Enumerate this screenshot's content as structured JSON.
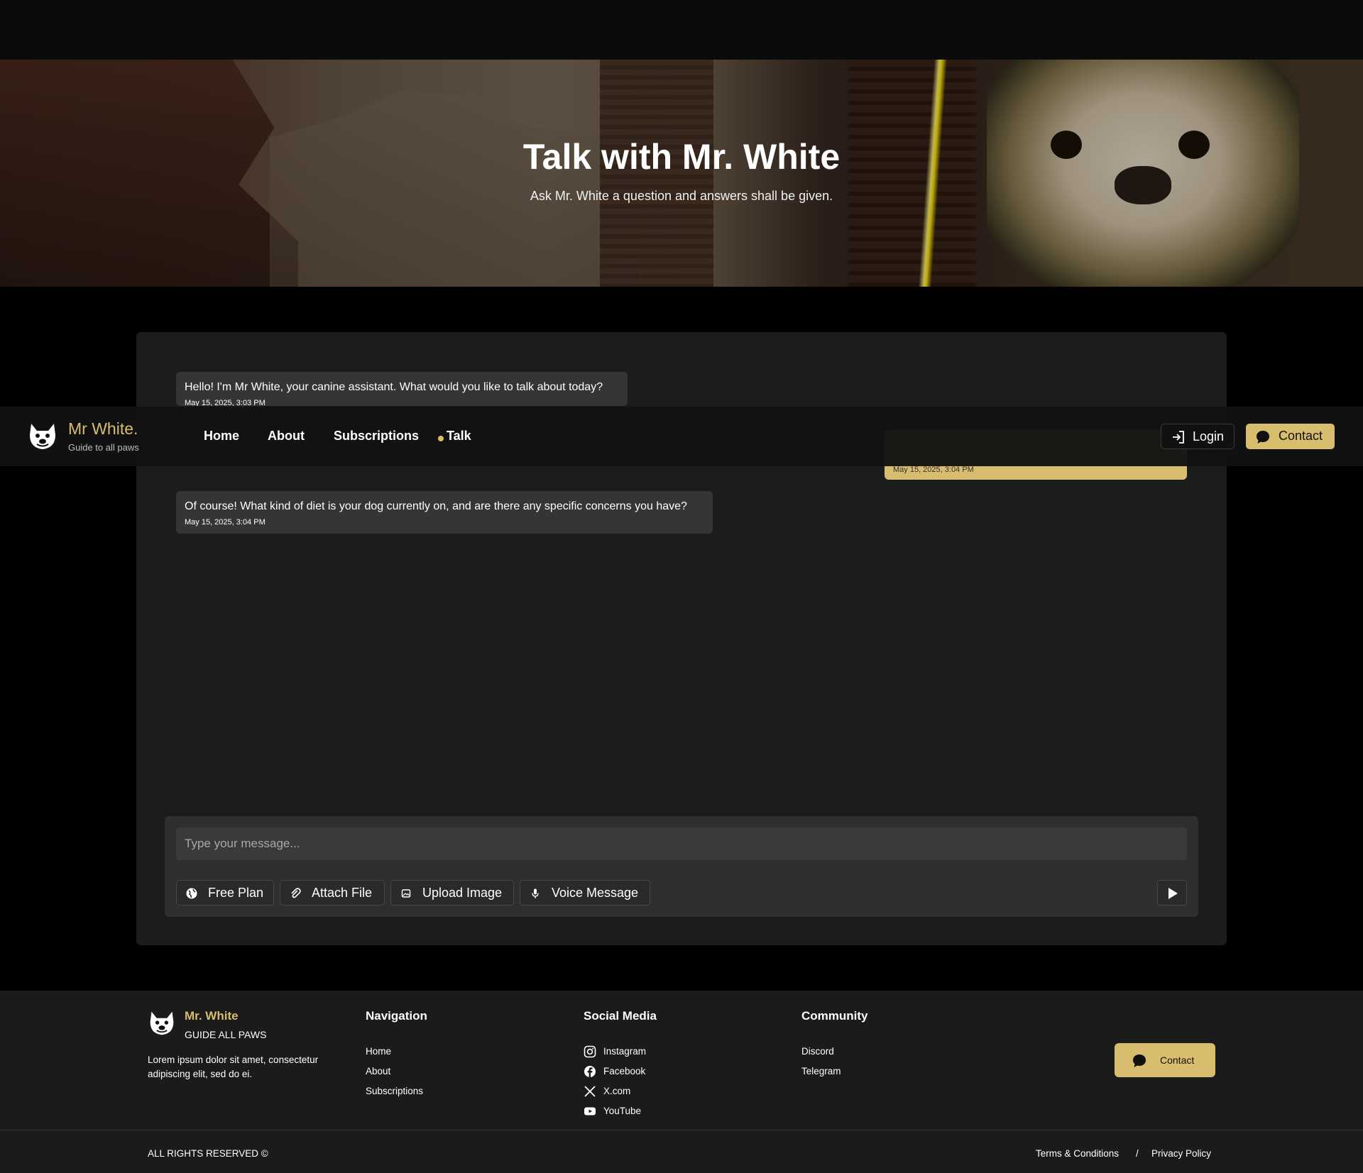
{
  "hero": {
    "title": "Talk with Mr. White",
    "subtitle": "Ask Mr. White a question and answers shall be given."
  },
  "nav": {
    "brand_name": "Mr White.",
    "brand_tagline": "Guide to all paws",
    "links": [
      {
        "label": "Home",
        "active": false
      },
      {
        "label": "About",
        "active": false
      },
      {
        "label": "Subscriptions",
        "active": false
      },
      {
        "label": "Talk",
        "active": true
      }
    ],
    "login_label": "Login",
    "contact_label": "Contact",
    "accent_color": "#d8bd6f"
  },
  "chat": {
    "messages": [
      {
        "from": "assistant",
        "text": "Hello! I'm Mr White, your canine assistant. What would you like to talk about today?",
        "time": "May 15, 2025, 3:03 PM"
      },
      {
        "from": "user",
        "text": "",
        "time": "May 15, 2025, 3:04 PM"
      },
      {
        "from": "assistant",
        "text": "Of course! What kind of diet is your dog currently on, and are there any specific concerns you have?",
        "time": "May 15, 2025, 3:04 PM"
      }
    ],
    "input_placeholder": "Type your message...",
    "tools": [
      {
        "label": "Free Plan",
        "icon": "globe-icon"
      },
      {
        "label": "Attach File",
        "icon": "paperclip-icon"
      },
      {
        "label": "Upload Image",
        "icon": "image-icon"
      },
      {
        "label": "Voice Message",
        "icon": "microphone-icon"
      }
    ],
    "send_icon": "play-icon"
  },
  "footer": {
    "brand_name": "Mr. White",
    "brand_tagline": "GUIDE ALL PAWS",
    "description": "Lorem ipsum dolor sit amet, consectetur adipiscing elit, sed do ei.",
    "navigation": {
      "title": "Navigation",
      "links": [
        "Home",
        "About",
        "Subscriptions"
      ]
    },
    "social": {
      "title": "Social Media",
      "links": [
        {
          "label": "Instagram",
          "icon": "instagram-icon"
        },
        {
          "label": "Facebook",
          "icon": "facebook-icon"
        },
        {
          "label": "X.com",
          "icon": "x-icon"
        },
        {
          "label": "YouTube",
          "icon": "youtube-icon"
        }
      ]
    },
    "community": {
      "title": "Community",
      "links": [
        "Discord",
        "Telegram"
      ]
    },
    "contact_label": "Contact",
    "rights": "ALL RIGHTS RESERVED ©",
    "terms": "Terms & Conditions",
    "separator": "/",
    "privacy": "Privacy Policy"
  }
}
